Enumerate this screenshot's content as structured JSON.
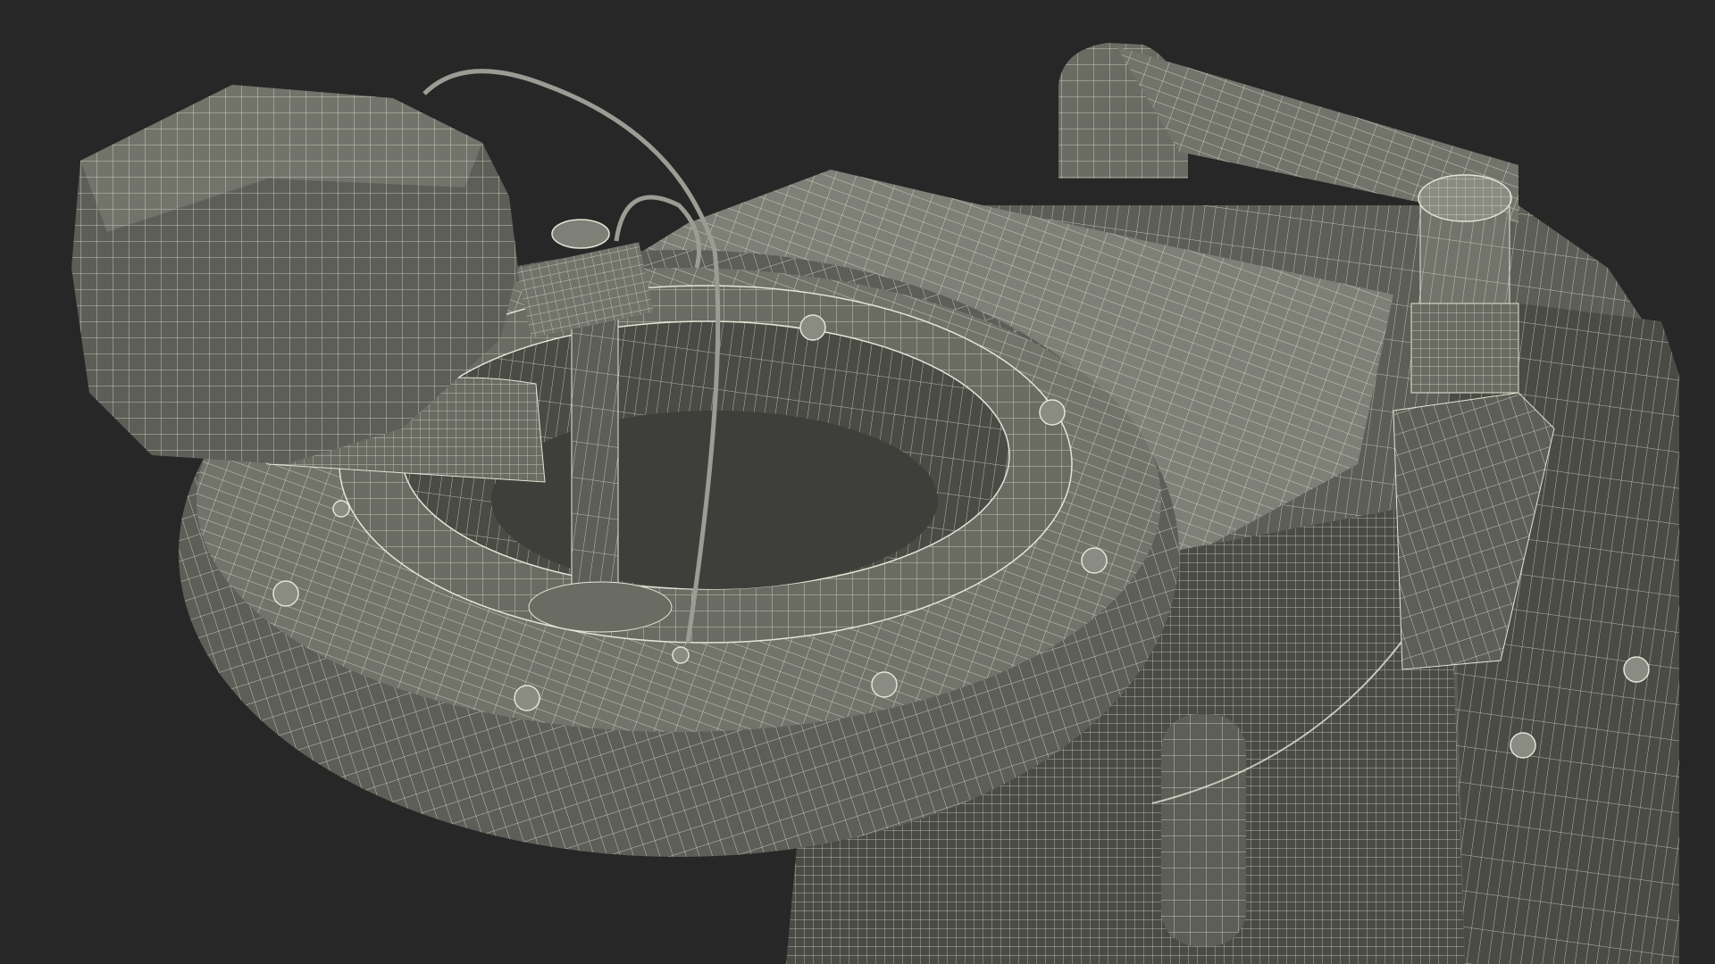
{
  "scene": {
    "subject": "wireframe-3d-render",
    "colors": {
      "background": "#272727",
      "shade_dark": "#4a4b45",
      "shade_mid": "#5d5e57",
      "shade_light": "#72736b",
      "shade_top": "#7e7f77",
      "wire": "#e6e4d6"
    }
  }
}
